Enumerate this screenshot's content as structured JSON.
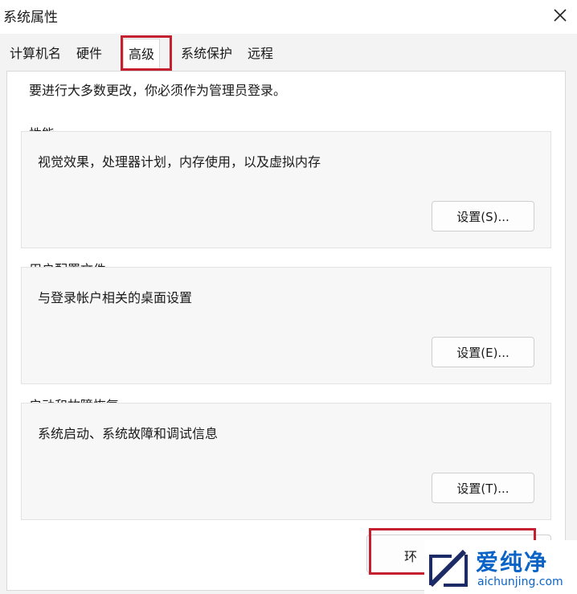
{
  "window": {
    "title": "系统属性"
  },
  "tabs": [
    {
      "label": "计算机名"
    },
    {
      "label": "硬件"
    },
    {
      "label": "高级"
    },
    {
      "label": "系统保护"
    },
    {
      "label": "远程"
    }
  ],
  "panel": {
    "admin_note": "要进行大多数更改，你必须作为管理员登录。",
    "groups": [
      {
        "label": "性能",
        "description": "视觉效果，处理器计划，内存使用，以及虚拟内存",
        "button": "设置(S)..."
      },
      {
        "label": "用户配置文件",
        "description": "与登录帐户相关的桌面设置",
        "button": "设置(E)..."
      },
      {
        "label": "启动和故障恢复",
        "description": "系统启动、系统故障和调试信息",
        "button": "设置(T)..."
      }
    ],
    "env_button": "环"
  },
  "watermark": {
    "brand": "爱纯净",
    "url": "aichunjing.com"
  },
  "colors": {
    "highlight": "#c4202f",
    "watermark_blue": "#0a64c8"
  }
}
